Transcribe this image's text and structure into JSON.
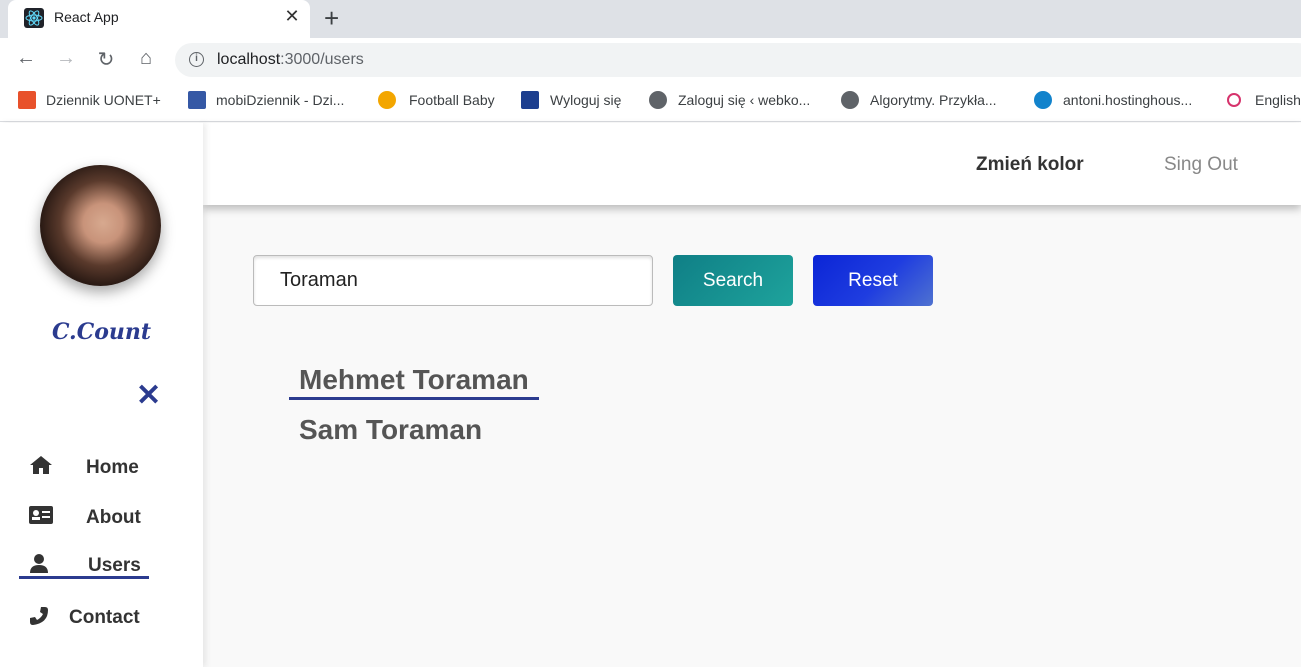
{
  "browser": {
    "tab_title": "React App",
    "url_host": "localhost",
    "url_path": ":3000/users",
    "bookmarks": [
      {
        "label": "Dziennik UONET+",
        "icon": "uonet-icon",
        "color": "#e8512b"
      },
      {
        "label": "mobiDziennik - Dzi...",
        "icon": "mobidziennik-icon",
        "color": "#3558a5"
      },
      {
        "label": "Football Baby",
        "icon": "football-baby-icon",
        "color": "#f3a600"
      },
      {
        "label": "Wyloguj się",
        "icon": "ul-icon",
        "color": "#1d3f8f"
      },
      {
        "label": "Zaloguj się ‹ webko...",
        "icon": "globe-icon",
        "color": "#5f6368"
      },
      {
        "label": "Algorytmy. Przykła...",
        "icon": "globe-icon",
        "color": "#5f6368"
      },
      {
        "label": "antoni.hostinghous...",
        "icon": "hosting-icon",
        "color": "#1283cc"
      },
      {
        "label": "English",
        "icon": "english-icon",
        "color": "#d6336c"
      }
    ]
  },
  "sidebar": {
    "brand": "C.Count",
    "items": [
      {
        "label": "Home",
        "icon": "home-icon"
      },
      {
        "label": "About",
        "icon": "id-card-icon"
      },
      {
        "label": "Users",
        "icon": "user-icon",
        "active": true
      },
      {
        "label": "Contact",
        "icon": "phone-icon"
      }
    ]
  },
  "header": {
    "change_color": "Zmień kolor",
    "sign_out": "Sing Out"
  },
  "search": {
    "value": "Toraman",
    "search_label": "Search",
    "reset_label": "Reset"
  },
  "results": [
    "Mehmet Toraman",
    "Sam Toraman"
  ],
  "colors": {
    "accent": "#2b3b8f",
    "search_button": "#15918f",
    "reset_button": "#1633d9"
  }
}
